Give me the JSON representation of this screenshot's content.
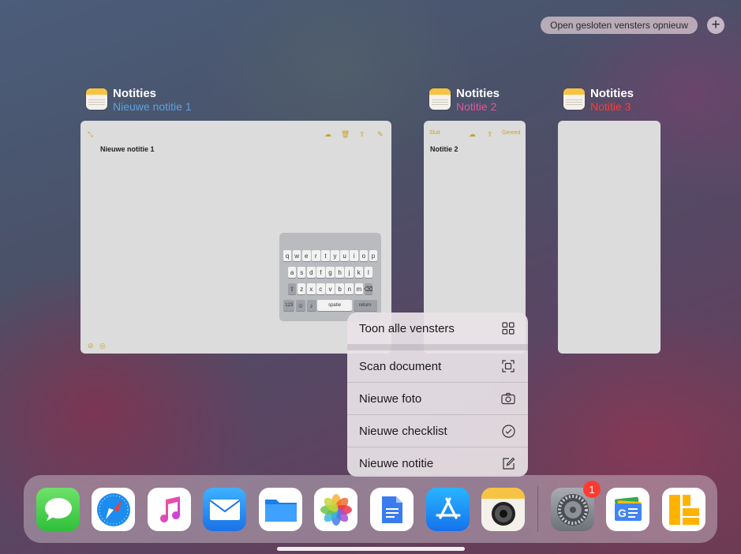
{
  "top_bar": {
    "reopen_label": "Open gesloten vensters opnieuw",
    "add_label": "+"
  },
  "windows": [
    {
      "app": "Notities",
      "subtitle": "Nieuwe notitie 1",
      "subtitle_color": "#5aa2dc",
      "note_title": "Nieuwe notitie 1"
    },
    {
      "app": "Notities",
      "subtitle": "Notitie 2",
      "subtitle_color": "#e0569a",
      "note_title": "Notitie 2",
      "left_label": "Sluit",
      "right_label": "Gereed"
    },
    {
      "app": "Notities",
      "subtitle": "Notitie 3",
      "subtitle_color": "#ff3b30"
    }
  ],
  "keyboard": {
    "row1": [
      "q",
      "w",
      "e",
      "r",
      "t",
      "y",
      "u",
      "i",
      "o",
      "p"
    ],
    "row2": [
      "a",
      "s",
      "d",
      "f",
      "g",
      "h",
      "j",
      "k",
      "l"
    ],
    "row3": [
      "z",
      "x",
      "c",
      "v",
      "b",
      "n",
      "m"
    ],
    "key_123": "123",
    "space": "spatie",
    "return": "return"
  },
  "menu": {
    "show_all": "Toon alle vensters",
    "scan": "Scan document",
    "photo": "Nieuwe foto",
    "checklist": "Nieuwe checklist",
    "note": "Nieuwe notitie"
  },
  "dock": {
    "apps": [
      "messages-icon",
      "safari-icon",
      "music-icon",
      "mail-icon",
      "files-icon",
      "photos-icon",
      "docs-icon",
      "app-store-icon",
      "notes-icon",
      "settings-icon",
      "news-icon",
      "keynote-icon"
    ],
    "settings_badge": "1"
  },
  "colors": {
    "accent_yellow": "#f6c342",
    "badge_red": "#ff3b30"
  }
}
